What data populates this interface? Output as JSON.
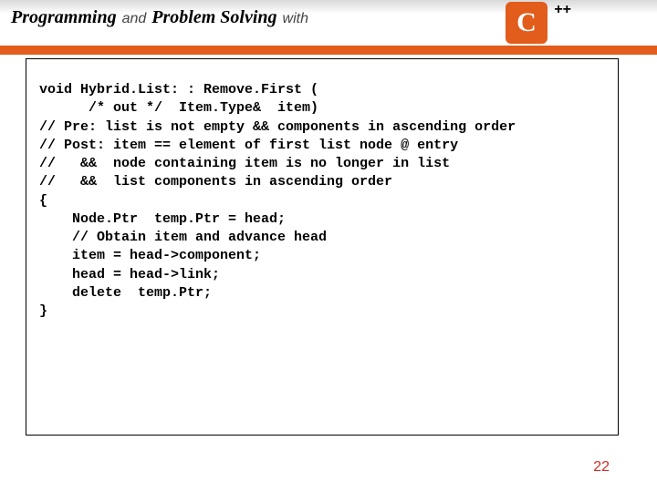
{
  "header": {
    "t1": "Programming",
    "t2": "and",
    "t3": "Problem Solving",
    "t4": "with",
    "logo_c": "C",
    "logo_pp": "++"
  },
  "code": {
    "l1": "void Hybrid.List: : Remove.First (",
    "l2": "      /* out */  Item.Type&  item)",
    "l3": "// Pre: list is not empty && components in ascending order",
    "l4": "// Post: item == element of first list node @ entry",
    "l5": "//   &&  node containing item is no longer in list",
    "l6": "//   &&  list components in ascending order",
    "l7": "{",
    "l8": "    Node.Ptr  temp.Ptr = head;",
    "l9": "    // Obtain item and advance head",
    "l10": "    item = head->component;",
    "l11": "    head = head->link;",
    "l12": "    delete  temp.Ptr;",
    "l13": "}"
  },
  "page_number": "22"
}
